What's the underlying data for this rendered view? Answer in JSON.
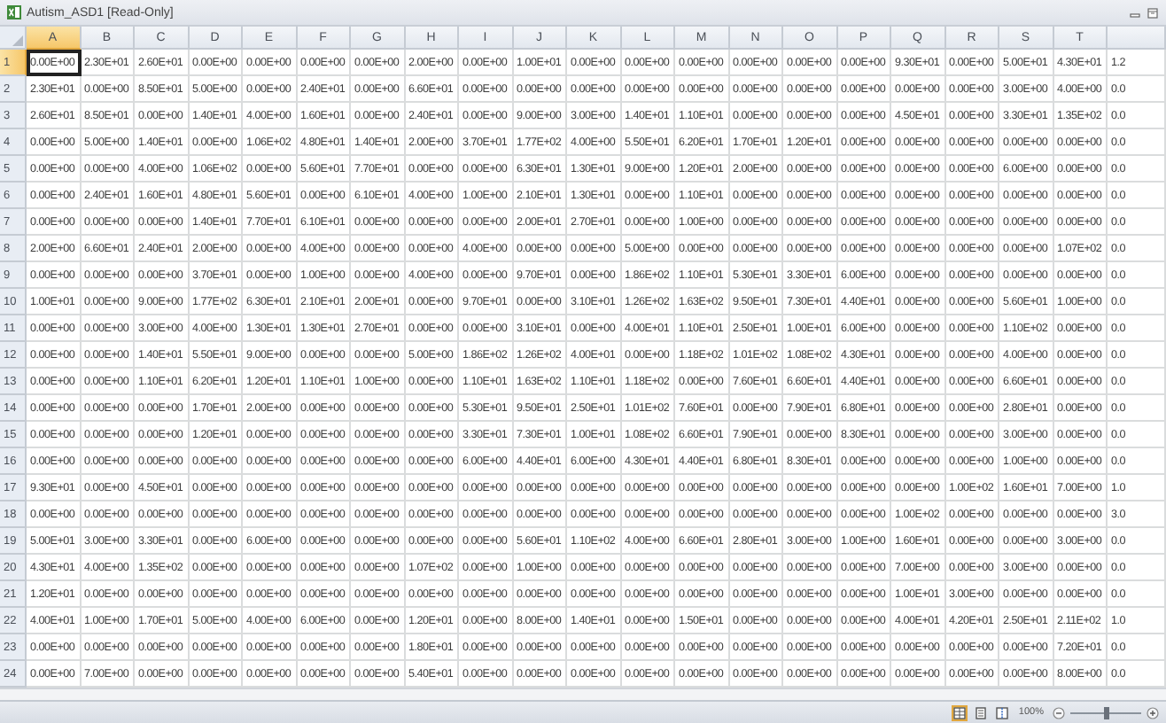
{
  "window": {
    "title": "Autism_ASD1 [Read-Only]"
  },
  "columns": [
    {
      "label": "A",
      "selected": true
    },
    {
      "label": "B",
      "selected": false
    },
    {
      "label": "C",
      "selected": false
    },
    {
      "label": "D",
      "selected": false
    },
    {
      "label": "E",
      "selected": false
    },
    {
      "label": "F",
      "selected": false
    },
    {
      "label": "G",
      "selected": false
    },
    {
      "label": "H",
      "selected": false
    },
    {
      "label": "I",
      "selected": false
    },
    {
      "label": "J",
      "selected": false
    },
    {
      "label": "K",
      "selected": false
    },
    {
      "label": "L",
      "selected": false
    },
    {
      "label": "M",
      "selected": false
    },
    {
      "label": "N",
      "selected": false
    },
    {
      "label": "O",
      "selected": false
    },
    {
      "label": "P",
      "selected": false
    },
    {
      "label": "Q",
      "selected": false
    },
    {
      "label": "R",
      "selected": false
    },
    {
      "label": "S",
      "selected": false
    },
    {
      "label": "T",
      "selected": false
    }
  ],
  "rows": [
    {
      "number": "1",
      "selected": true,
      "cells": [
        "0.00E+00",
        "2.30E+01",
        "2.60E+01",
        "0.00E+00",
        "0.00E+00",
        "0.00E+00",
        "0.00E+00",
        "2.00E+00",
        "0.00E+00",
        "1.00E+01",
        "0.00E+00",
        "0.00E+00",
        "0.00E+00",
        "0.00E+00",
        "0.00E+00",
        "0.00E+00",
        "9.30E+01",
        "0.00E+00",
        "5.00E+01",
        "4.30E+01",
        "1.2"
      ]
    },
    {
      "number": "2",
      "selected": false,
      "cells": [
        "2.30E+01",
        "0.00E+00",
        "8.50E+01",
        "5.00E+00",
        "0.00E+00",
        "2.40E+01",
        "0.00E+00",
        "6.60E+01",
        "0.00E+00",
        "0.00E+00",
        "0.00E+00",
        "0.00E+00",
        "0.00E+00",
        "0.00E+00",
        "0.00E+00",
        "0.00E+00",
        "0.00E+00",
        "0.00E+00",
        "3.00E+00",
        "4.00E+00",
        "0.0"
      ]
    },
    {
      "number": "3",
      "selected": false,
      "cells": [
        "2.60E+01",
        "8.50E+01",
        "0.00E+00",
        "1.40E+01",
        "4.00E+00",
        "1.60E+01",
        "0.00E+00",
        "2.40E+01",
        "0.00E+00",
        "9.00E+00",
        "3.00E+00",
        "1.40E+01",
        "1.10E+01",
        "0.00E+00",
        "0.00E+00",
        "0.00E+00",
        "4.50E+01",
        "0.00E+00",
        "3.30E+01",
        "1.35E+02",
        "0.0"
      ]
    },
    {
      "number": "4",
      "selected": false,
      "cells": [
        "0.00E+00",
        "5.00E+00",
        "1.40E+01",
        "0.00E+00",
        "1.06E+02",
        "4.80E+01",
        "1.40E+01",
        "2.00E+00",
        "3.70E+01",
        "1.77E+02",
        "4.00E+00",
        "5.50E+01",
        "6.20E+01",
        "1.70E+01",
        "1.20E+01",
        "0.00E+00",
        "0.00E+00",
        "0.00E+00",
        "0.00E+00",
        "0.00E+00",
        "0.0"
      ]
    },
    {
      "number": "5",
      "selected": false,
      "cells": [
        "0.00E+00",
        "0.00E+00",
        "4.00E+00",
        "1.06E+02",
        "0.00E+00",
        "5.60E+01",
        "7.70E+01",
        "0.00E+00",
        "0.00E+00",
        "6.30E+01",
        "1.30E+01",
        "9.00E+00",
        "1.20E+01",
        "2.00E+00",
        "0.00E+00",
        "0.00E+00",
        "0.00E+00",
        "0.00E+00",
        "6.00E+00",
        "0.00E+00",
        "0.0"
      ]
    },
    {
      "number": "6",
      "selected": false,
      "cells": [
        "0.00E+00",
        "2.40E+01",
        "1.60E+01",
        "4.80E+01",
        "5.60E+01",
        "0.00E+00",
        "6.10E+01",
        "4.00E+00",
        "1.00E+00",
        "2.10E+01",
        "1.30E+01",
        "0.00E+00",
        "1.10E+01",
        "0.00E+00",
        "0.00E+00",
        "0.00E+00",
        "0.00E+00",
        "0.00E+00",
        "0.00E+00",
        "0.00E+00",
        "0.0"
      ]
    },
    {
      "number": "7",
      "selected": false,
      "cells": [
        "0.00E+00",
        "0.00E+00",
        "0.00E+00",
        "1.40E+01",
        "7.70E+01",
        "6.10E+01",
        "0.00E+00",
        "0.00E+00",
        "0.00E+00",
        "2.00E+01",
        "2.70E+01",
        "0.00E+00",
        "1.00E+00",
        "0.00E+00",
        "0.00E+00",
        "0.00E+00",
        "0.00E+00",
        "0.00E+00",
        "0.00E+00",
        "0.00E+00",
        "0.0"
      ]
    },
    {
      "number": "8",
      "selected": false,
      "cells": [
        "2.00E+00",
        "6.60E+01",
        "2.40E+01",
        "2.00E+00",
        "0.00E+00",
        "4.00E+00",
        "0.00E+00",
        "0.00E+00",
        "4.00E+00",
        "0.00E+00",
        "0.00E+00",
        "5.00E+00",
        "0.00E+00",
        "0.00E+00",
        "0.00E+00",
        "0.00E+00",
        "0.00E+00",
        "0.00E+00",
        "0.00E+00",
        "1.07E+02",
        "0.0"
      ]
    },
    {
      "number": "9",
      "selected": false,
      "cells": [
        "0.00E+00",
        "0.00E+00",
        "0.00E+00",
        "3.70E+01",
        "0.00E+00",
        "1.00E+00",
        "0.00E+00",
        "4.00E+00",
        "0.00E+00",
        "9.70E+01",
        "0.00E+00",
        "1.86E+02",
        "1.10E+01",
        "5.30E+01",
        "3.30E+01",
        "6.00E+00",
        "0.00E+00",
        "0.00E+00",
        "0.00E+00",
        "0.00E+00",
        "0.0"
      ]
    },
    {
      "number": "10",
      "selected": false,
      "cells": [
        "1.00E+01",
        "0.00E+00",
        "9.00E+00",
        "1.77E+02",
        "6.30E+01",
        "2.10E+01",
        "2.00E+01",
        "0.00E+00",
        "9.70E+01",
        "0.00E+00",
        "3.10E+01",
        "1.26E+02",
        "1.63E+02",
        "9.50E+01",
        "7.30E+01",
        "4.40E+01",
        "0.00E+00",
        "0.00E+00",
        "5.60E+01",
        "1.00E+00",
        "0.0"
      ]
    },
    {
      "number": "11",
      "selected": false,
      "cells": [
        "0.00E+00",
        "0.00E+00",
        "3.00E+00",
        "4.00E+00",
        "1.30E+01",
        "1.30E+01",
        "2.70E+01",
        "0.00E+00",
        "0.00E+00",
        "3.10E+01",
        "0.00E+00",
        "4.00E+01",
        "1.10E+01",
        "2.50E+01",
        "1.00E+01",
        "6.00E+00",
        "0.00E+00",
        "0.00E+00",
        "1.10E+02",
        "0.00E+00",
        "0.0"
      ]
    },
    {
      "number": "12",
      "selected": false,
      "cells": [
        "0.00E+00",
        "0.00E+00",
        "1.40E+01",
        "5.50E+01",
        "9.00E+00",
        "0.00E+00",
        "0.00E+00",
        "5.00E+00",
        "1.86E+02",
        "1.26E+02",
        "4.00E+01",
        "0.00E+00",
        "1.18E+02",
        "1.01E+02",
        "1.08E+02",
        "4.30E+01",
        "0.00E+00",
        "0.00E+00",
        "4.00E+00",
        "0.00E+00",
        "0.0"
      ]
    },
    {
      "number": "13",
      "selected": false,
      "cells": [
        "0.00E+00",
        "0.00E+00",
        "1.10E+01",
        "6.20E+01",
        "1.20E+01",
        "1.10E+01",
        "1.00E+00",
        "0.00E+00",
        "1.10E+01",
        "1.63E+02",
        "1.10E+01",
        "1.18E+02",
        "0.00E+00",
        "7.60E+01",
        "6.60E+01",
        "4.40E+01",
        "0.00E+00",
        "0.00E+00",
        "6.60E+01",
        "0.00E+00",
        "0.0"
      ]
    },
    {
      "number": "14",
      "selected": false,
      "cells": [
        "0.00E+00",
        "0.00E+00",
        "0.00E+00",
        "1.70E+01",
        "2.00E+00",
        "0.00E+00",
        "0.00E+00",
        "0.00E+00",
        "5.30E+01",
        "9.50E+01",
        "2.50E+01",
        "1.01E+02",
        "7.60E+01",
        "0.00E+00",
        "7.90E+01",
        "6.80E+01",
        "0.00E+00",
        "0.00E+00",
        "2.80E+01",
        "0.00E+00",
        "0.0"
      ]
    },
    {
      "number": "15",
      "selected": false,
      "cells": [
        "0.00E+00",
        "0.00E+00",
        "0.00E+00",
        "1.20E+01",
        "0.00E+00",
        "0.00E+00",
        "0.00E+00",
        "0.00E+00",
        "3.30E+01",
        "7.30E+01",
        "1.00E+01",
        "1.08E+02",
        "6.60E+01",
        "7.90E+01",
        "0.00E+00",
        "8.30E+01",
        "0.00E+00",
        "0.00E+00",
        "3.00E+00",
        "0.00E+00",
        "0.0"
      ]
    },
    {
      "number": "16",
      "selected": false,
      "cells": [
        "0.00E+00",
        "0.00E+00",
        "0.00E+00",
        "0.00E+00",
        "0.00E+00",
        "0.00E+00",
        "0.00E+00",
        "0.00E+00",
        "6.00E+00",
        "4.40E+01",
        "6.00E+00",
        "4.30E+01",
        "4.40E+01",
        "6.80E+01",
        "8.30E+01",
        "0.00E+00",
        "0.00E+00",
        "0.00E+00",
        "1.00E+00",
        "0.00E+00",
        "0.0"
      ]
    },
    {
      "number": "17",
      "selected": false,
      "cells": [
        "9.30E+01",
        "0.00E+00",
        "4.50E+01",
        "0.00E+00",
        "0.00E+00",
        "0.00E+00",
        "0.00E+00",
        "0.00E+00",
        "0.00E+00",
        "0.00E+00",
        "0.00E+00",
        "0.00E+00",
        "0.00E+00",
        "0.00E+00",
        "0.00E+00",
        "0.00E+00",
        "0.00E+00",
        "1.00E+02",
        "1.60E+01",
        "7.00E+00",
        "1.0"
      ]
    },
    {
      "number": "18",
      "selected": false,
      "cells": [
        "0.00E+00",
        "0.00E+00",
        "0.00E+00",
        "0.00E+00",
        "0.00E+00",
        "0.00E+00",
        "0.00E+00",
        "0.00E+00",
        "0.00E+00",
        "0.00E+00",
        "0.00E+00",
        "0.00E+00",
        "0.00E+00",
        "0.00E+00",
        "0.00E+00",
        "0.00E+00",
        "1.00E+02",
        "0.00E+00",
        "0.00E+00",
        "0.00E+00",
        "3.0"
      ]
    },
    {
      "number": "19",
      "selected": false,
      "cells": [
        "5.00E+01",
        "3.00E+00",
        "3.30E+01",
        "0.00E+00",
        "6.00E+00",
        "0.00E+00",
        "0.00E+00",
        "0.00E+00",
        "0.00E+00",
        "5.60E+01",
        "1.10E+02",
        "4.00E+00",
        "6.60E+01",
        "2.80E+01",
        "3.00E+00",
        "1.00E+00",
        "1.60E+01",
        "0.00E+00",
        "0.00E+00",
        "3.00E+00",
        "0.0"
      ]
    },
    {
      "number": "20",
      "selected": false,
      "cells": [
        "4.30E+01",
        "4.00E+00",
        "1.35E+02",
        "0.00E+00",
        "0.00E+00",
        "0.00E+00",
        "0.00E+00",
        "1.07E+02",
        "0.00E+00",
        "1.00E+00",
        "0.00E+00",
        "0.00E+00",
        "0.00E+00",
        "0.00E+00",
        "0.00E+00",
        "0.00E+00",
        "7.00E+00",
        "0.00E+00",
        "3.00E+00",
        "0.00E+00",
        "0.0"
      ]
    },
    {
      "number": "21",
      "selected": false,
      "cells": [
        "1.20E+01",
        "0.00E+00",
        "0.00E+00",
        "0.00E+00",
        "0.00E+00",
        "0.00E+00",
        "0.00E+00",
        "0.00E+00",
        "0.00E+00",
        "0.00E+00",
        "0.00E+00",
        "0.00E+00",
        "0.00E+00",
        "0.00E+00",
        "0.00E+00",
        "0.00E+00",
        "1.00E+01",
        "3.00E+00",
        "0.00E+00",
        "0.00E+00",
        "0.0"
      ]
    },
    {
      "number": "22",
      "selected": false,
      "cells": [
        "4.00E+01",
        "1.00E+00",
        "1.70E+01",
        "5.00E+00",
        "4.00E+00",
        "6.00E+00",
        "0.00E+00",
        "1.20E+01",
        "0.00E+00",
        "8.00E+00",
        "1.40E+01",
        "0.00E+00",
        "1.50E+01",
        "0.00E+00",
        "0.00E+00",
        "0.00E+00",
        "4.00E+01",
        "4.20E+01",
        "2.50E+01",
        "2.11E+02",
        "1.0"
      ]
    },
    {
      "number": "23",
      "selected": false,
      "cells": [
        "0.00E+00",
        "0.00E+00",
        "0.00E+00",
        "0.00E+00",
        "0.00E+00",
        "0.00E+00",
        "0.00E+00",
        "1.80E+01",
        "0.00E+00",
        "0.00E+00",
        "0.00E+00",
        "0.00E+00",
        "0.00E+00",
        "0.00E+00",
        "0.00E+00",
        "0.00E+00",
        "0.00E+00",
        "0.00E+00",
        "0.00E+00",
        "7.20E+01",
        "0.0"
      ]
    },
    {
      "number": "24",
      "selected": false,
      "cells": [
        "0.00E+00",
        "7.00E+00",
        "0.00E+00",
        "0.00E+00",
        "0.00E+00",
        "0.00E+00",
        "0.00E+00",
        "5.40E+01",
        "0.00E+00",
        "0.00E+00",
        "0.00E+00",
        "0.00E+00",
        "0.00E+00",
        "0.00E+00",
        "0.00E+00",
        "0.00E+00",
        "0.00E+00",
        "0.00E+00",
        "0.00E+00",
        "8.00E+00",
        "0.0"
      ]
    }
  ],
  "status_bar": {
    "views": [
      {
        "kind": "normal",
        "selected": true
      },
      {
        "kind": "page_layout",
        "selected": false
      },
      {
        "kind": "page_break",
        "selected": false
      }
    ],
    "zoom": "100%",
    "zoom_slider": {
      "level": 0.5
    }
  }
}
